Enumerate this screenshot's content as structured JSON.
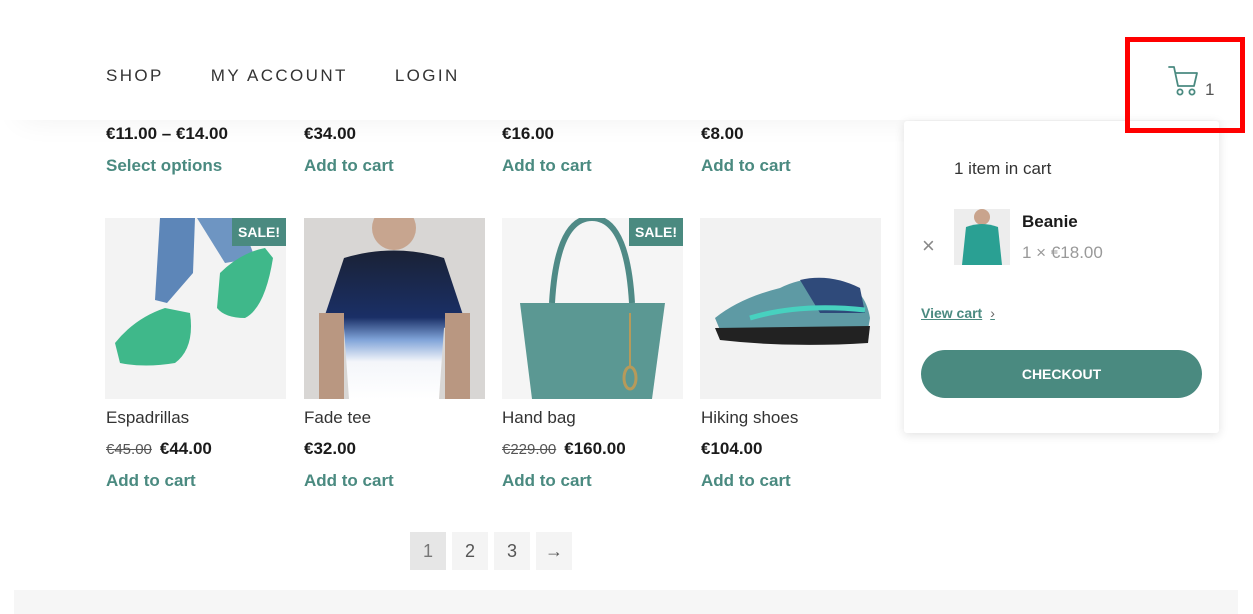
{
  "nav": {
    "items": [
      "SHOP",
      "MY ACCOUNT",
      "LOGIN"
    ]
  },
  "cart": {
    "count": "1",
    "icon": "cart-icon"
  },
  "upper_row": [
    {
      "price": "€11.00 – €14.00",
      "action": "Select options"
    },
    {
      "price": "€34.00",
      "action": "Add to cart"
    },
    {
      "price": "€16.00",
      "action": "Add to cart"
    },
    {
      "price": "€8.00",
      "action": "Add to cart"
    }
  ],
  "products": [
    {
      "title": "Espadrillas",
      "old_price": "€45.00",
      "price": "€44.00",
      "action": "Add to cart",
      "badge": "SALE!"
    },
    {
      "title": "Fade tee",
      "old_price": "",
      "price": "€32.00",
      "action": "Add to cart",
      "badge": ""
    },
    {
      "title": "Hand bag",
      "old_price": "€229.00",
      "price": "€160.00",
      "action": "Add to cart",
      "badge": "SALE!"
    },
    {
      "title": "Hiking shoes",
      "old_price": "",
      "price": "€104.00",
      "action": "Add to cart",
      "badge": ""
    }
  ],
  "pagination": {
    "pages": [
      "1",
      "2",
      "3"
    ],
    "next": "→",
    "current": "1"
  },
  "mini_cart": {
    "title": "1 item in cart",
    "item": {
      "name": "Beanie",
      "qty": "1 × €18.00"
    },
    "remove": "×",
    "view_cart": "View cart",
    "checkout": "CHECKOUT"
  },
  "colors": {
    "accent": "#4a8a80",
    "highlight": "#ff0000"
  }
}
